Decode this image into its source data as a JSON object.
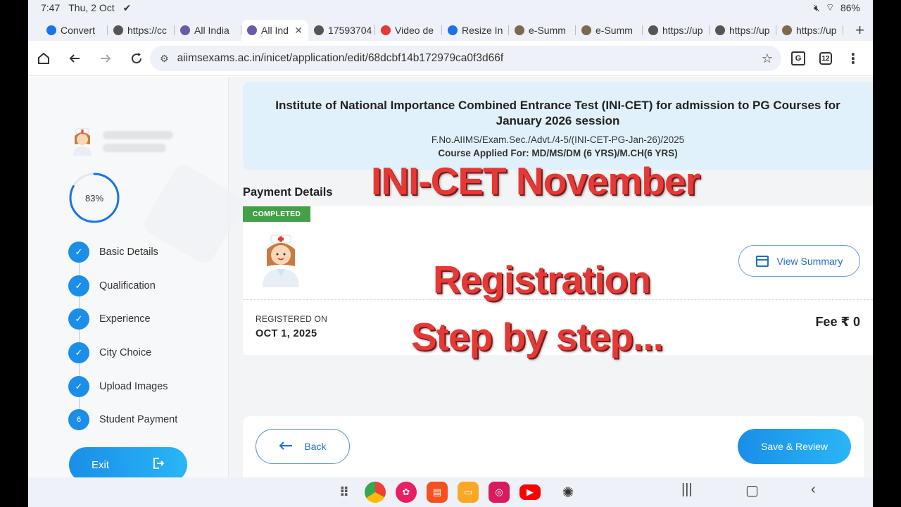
{
  "status": {
    "time": "7:47",
    "date": "Thu, 2 Oct",
    "battery": "86%"
  },
  "tabs": [
    {
      "label": "Convert ",
      "color": "#1a73e8"
    },
    {
      "label": "https://cc",
      "color": "#555555"
    },
    {
      "label": "All India",
      "color": "#6b5aa8"
    },
    {
      "label": "All Ind",
      "color": "#6b5aa8",
      "active": true
    },
    {
      "label": "17593704",
      "color": "#555555"
    },
    {
      "label": "Video de",
      "color": "#e53935"
    },
    {
      "label": "Resize In",
      "color": "#1a73e8"
    },
    {
      "label": "e-Summ",
      "color": "#7b6b4a"
    },
    {
      "label": "e-Summ",
      "color": "#7b6b4a"
    },
    {
      "label": "https://up",
      "color": "#555555"
    },
    {
      "label": "https://up",
      "color": "#555555"
    },
    {
      "label": "https://up",
      "color": "#7b6b4a"
    }
  ],
  "tab_close": "✕",
  "new_tab": "+",
  "toolbar": {
    "url": "aiimsexams.ac.in/inicet/application/edit/68dcbf14b172979ca0f3d66f",
    "tab_count": "12"
  },
  "sidebar": {
    "progress": 83,
    "progress_label": "83%",
    "steps": [
      {
        "label": "Basic Details",
        "done": true
      },
      {
        "label": "Qualification",
        "done": true
      },
      {
        "label": "Experience",
        "done": true
      },
      {
        "label": "City Choice",
        "done": true
      },
      {
        "label": "Upload Images",
        "done": true
      },
      {
        "label": "Student Payment",
        "done": false,
        "number": "6"
      }
    ],
    "check": "✓",
    "exit_label": "Exit"
  },
  "header": {
    "title": "Institute of National Importance Combined Entrance Test (INI-CET) for admission to PG Courses for January 2026 session",
    "ref": "F.No.AIIMS/Exam.Sec./Advt./4-5/(INI-CET-PG-Jan-26)/2025",
    "course_prefix": "Course Applied For: ",
    "course_value": "MD/MS/DM (6 YRS)/M.CH(6 YRS)"
  },
  "payment": {
    "section_title": "Payment Details",
    "badge": "COMPLETED",
    "view_summary": "View Summary",
    "registered_label": "REGISTERED ON",
    "registered_date": "OCT 1, 2025",
    "fee": "Fee ₹ 0"
  },
  "footer": {
    "back_label": "Back",
    "save_label": "Save & Review"
  },
  "overlay": {
    "line1": "INI-CET November",
    "line2": "Registration",
    "line3": "Step by step..."
  },
  "colors": {
    "primary": "#1a8ee8",
    "success": "#43a047",
    "overlay_red": "#e53935",
    "header_bg": "#e1f1fc"
  }
}
